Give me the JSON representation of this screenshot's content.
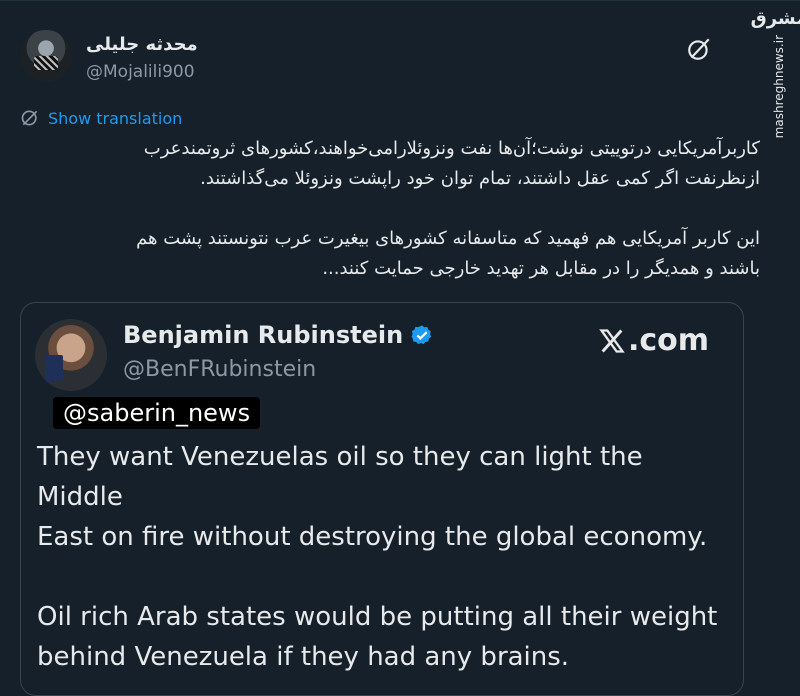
{
  "tweet": {
    "author_name": "محدثه جلیلی",
    "author_handle": "@Mojalili900",
    "show_translation": "Show translation",
    "text": "کاربرآمریکایی درتوییتی نوشت؛آن‌ها نفت ونزوئلارامی‌خواهند،کشورهای ثروتمندعرب\nازنظرنفت اگر کمی عقل داشتند، تمام توان خود راپشت ونزوئلا می‌گذاشتند.\n\nاین  کاربر آمریکایی هم فهمید که متاسفانه کشورهای بیغیرت عرب نتونستند پشت هم\nباشند و همدیگر را در مقابل هر تهدید خارجی حمایت کنند..."
  },
  "quote": {
    "author_name": "Benjamin Rubinstein",
    "author_handle": "@BenFRubinstein",
    "site_label": ".com",
    "overlay_tag": "@saberin_news",
    "text": "They want Venezuelas oil so they can light the Middle\nEast on fire without destroying the global economy.\n\nOil rich Arab states would be putting all their weight\nbehind Venezuela if they had any brains."
  },
  "watermark": {
    "logo": "مشرق",
    "url": "mashreghnews.ir"
  },
  "colors": {
    "background": "#15202b",
    "accent": "#1d9bf0",
    "muted": "#8b98a5"
  }
}
